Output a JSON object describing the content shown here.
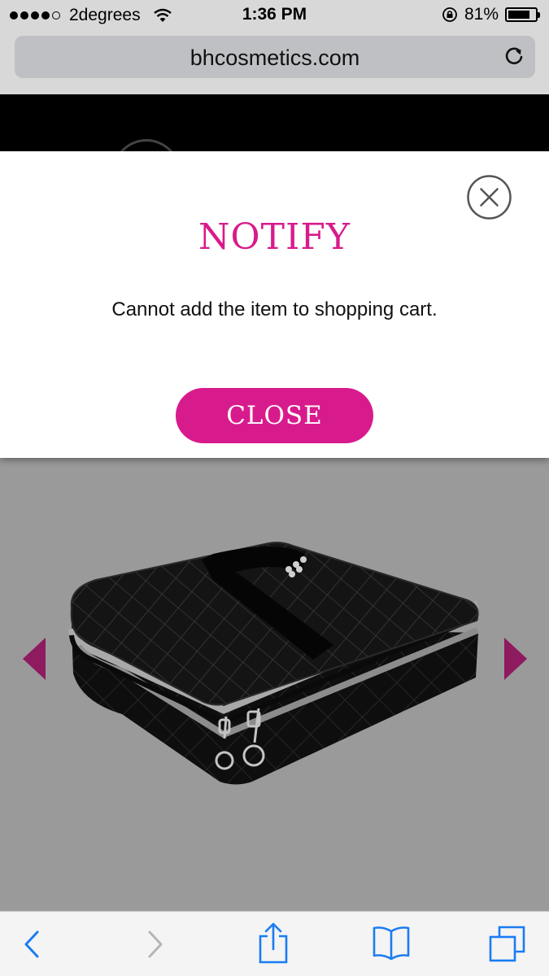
{
  "status_bar": {
    "carrier": "2degrees",
    "time": "1:36 PM",
    "battery_percent": "81%",
    "battery_level": 0.81,
    "signal_bars": 4
  },
  "browser": {
    "url": "bhcosmetics.com"
  },
  "modal": {
    "title": "NOTIFY",
    "message": "Cannot add the item to shopping cart.",
    "close_button_label": "CLOSE"
  },
  "colors": {
    "accent": "#d81b8c",
    "gallery_arrow": "#8e1a5f",
    "ios_blue": "#1a7cf2"
  },
  "icons": {
    "modal_close": "close-circle-icon",
    "reload": "reload-icon",
    "back": "back-chevron-icon",
    "forward": "forward-chevron-icon",
    "share": "share-icon",
    "bookmarks": "bookmarks-icon",
    "tabs": "tabs-icon"
  }
}
